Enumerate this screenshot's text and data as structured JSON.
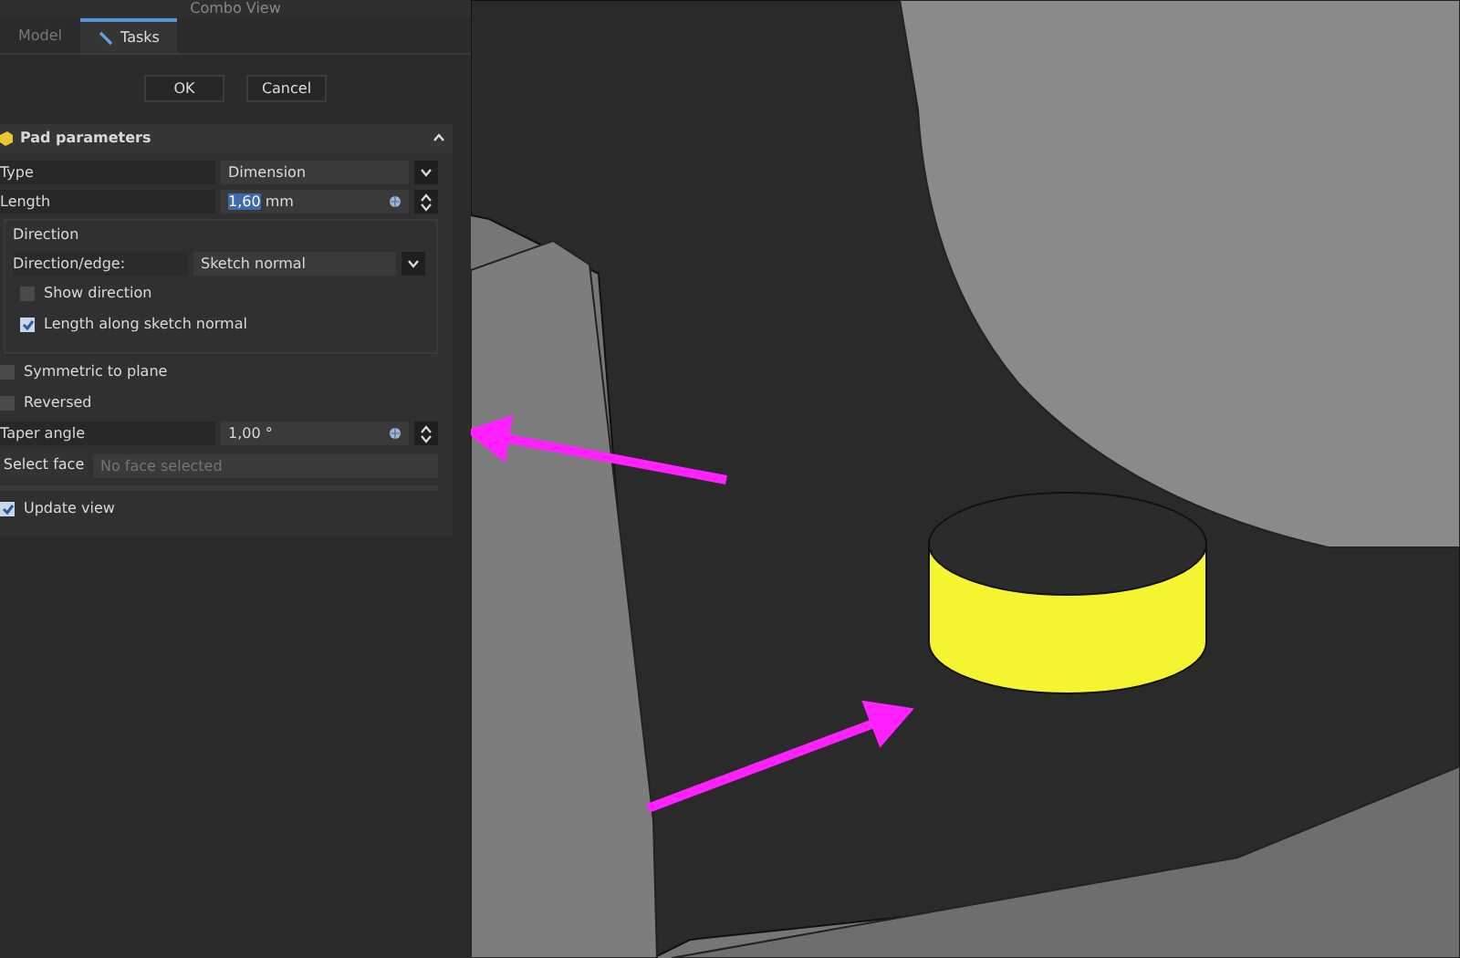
{
  "panel_title": "Combo View",
  "tabs": [
    {
      "label": "Model",
      "selected": false
    },
    {
      "label": "Tasks",
      "selected": true
    }
  ],
  "buttons": [
    "OK",
    "Cancel"
  ],
  "section": {
    "title": "Pad parameters",
    "expanded": true
  },
  "type": {
    "label": "Type",
    "value": "Dimension"
  },
  "length": {
    "label": "Length",
    "value": "1,60",
    "unit": "mm"
  },
  "direction": {
    "title": "Direction",
    "edge_label": "Direction/edge:",
    "edge_value": "Sketch normal",
    "options": [
      {
        "label": "Show direction",
        "checked": false
      },
      {
        "label": "Length along sketch normal",
        "checked": true
      }
    ]
  },
  "options": [
    {
      "label": "Symmetric to plane",
      "checked": false
    },
    {
      "label": "Reversed",
      "checked": false
    }
  ],
  "taper": {
    "label": "Taper angle",
    "value": "1,00 °"
  },
  "select_face": {
    "button": "Select face",
    "placeholder": "No face selected"
  },
  "update_view": {
    "label": "Update view",
    "checked": true
  }
}
